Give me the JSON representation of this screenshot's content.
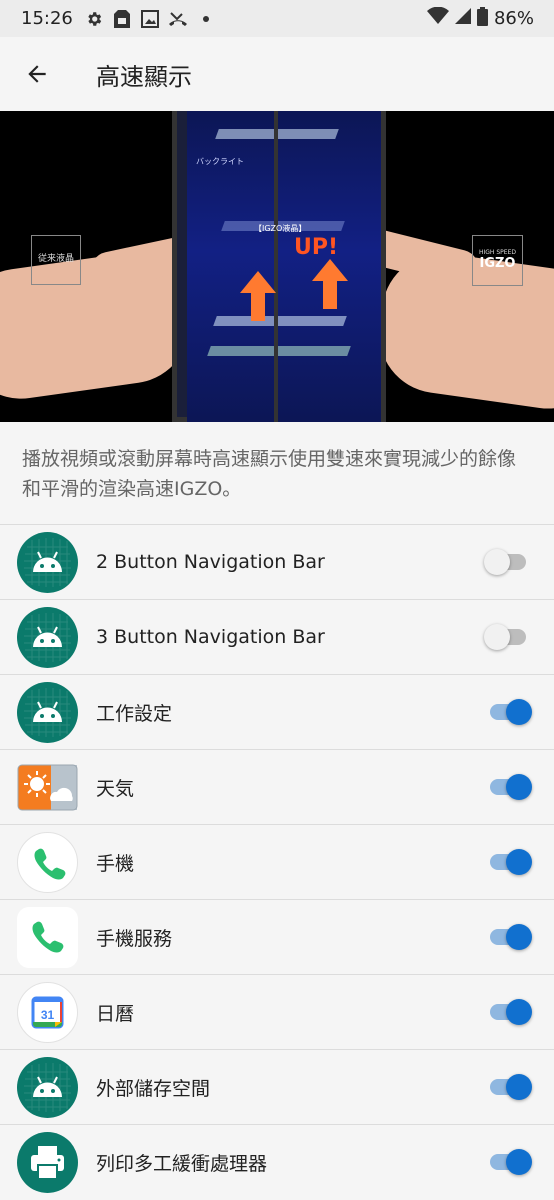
{
  "status_bar": {
    "time": "15:26",
    "battery": "86%"
  },
  "app_bar": {
    "title": "高速顯示"
  },
  "hero": {
    "left_label": "従来液晶",
    "right_label_top": "HIGH SPEED",
    "right_label_main": "IGZO",
    "phone_heading": "バックライト",
    "phone_mid_label": "【IGZO液晶】",
    "phone_up_text": "UP!"
  },
  "description": "播放視頻或滾動屏幕時高速顯示使用雙速來實現減少的餘像和平滑的渲染高速IGZO。",
  "apps": [
    {
      "name": "2 Button Navigation Bar",
      "icon": "android-icon",
      "enabled": false
    },
    {
      "name": "3 Button Navigation Bar",
      "icon": "android-icon",
      "enabled": false
    },
    {
      "name": "工作設定",
      "icon": "android-icon",
      "enabled": true
    },
    {
      "name": "天気",
      "icon": "weather-icon",
      "enabled": true
    },
    {
      "name": "手機",
      "icon": "phone-icon",
      "enabled": true
    },
    {
      "name": "手機服務",
      "icon": "phone-services-icon",
      "enabled": true
    },
    {
      "name": "日曆",
      "icon": "calendar-icon",
      "calendar_day": "31",
      "enabled": true
    },
    {
      "name": "外部儲存空間",
      "icon": "android-icon",
      "enabled": true
    },
    {
      "name": "列印多工緩衝處理器",
      "icon": "printer-icon",
      "enabled": true
    }
  ],
  "colors": {
    "accent": "#1170cf",
    "android_green": "#0b7a6b"
  }
}
